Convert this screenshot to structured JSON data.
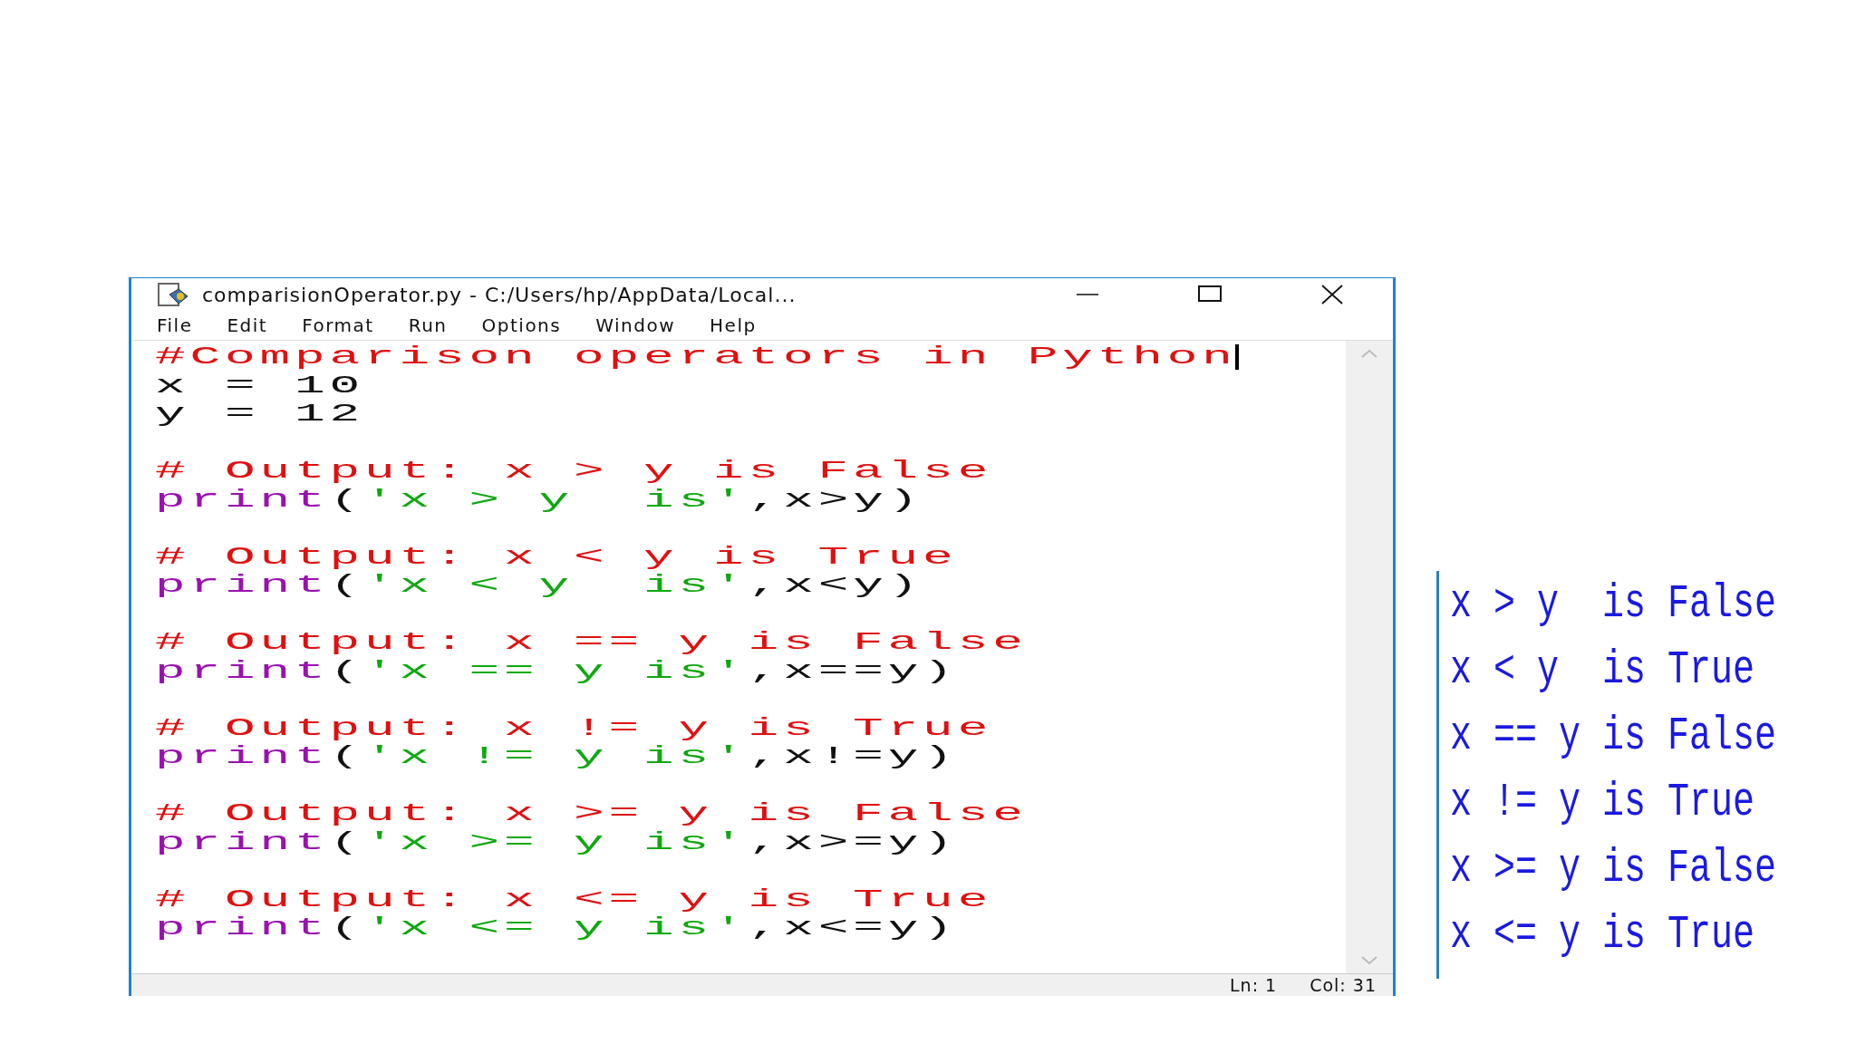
{
  "window": {
    "title": "comparisionOperator.py - C:/Users/hp/AppData/Local..."
  },
  "menu": [
    "File",
    "Edit",
    "Format",
    "Run",
    "Options",
    "Window",
    "Help"
  ],
  "editor": {
    "blocks": [
      {
        "lines": [
          {
            "cursor": true,
            "segments": [
              {
                "kind": "comment",
                "text": "#Comparison operators in Python"
              }
            ]
          },
          {
            "cursor": false,
            "segments": [
              {
                "kind": "plain",
                "text": "x = 10"
              }
            ]
          },
          {
            "cursor": false,
            "segments": [
              {
                "kind": "plain",
                "text": "y = 12"
              }
            ]
          }
        ]
      },
      {
        "lines": [
          {
            "cursor": false,
            "segments": [
              {
                "kind": "comment",
                "text": "# Output: x > y is False"
              }
            ]
          },
          {
            "cursor": false,
            "segments": [
              {
                "kind": "builtin",
                "text": "print"
              },
              {
                "kind": "plain",
                "text": "("
              },
              {
                "kind": "string",
                "text": "'x > y  is'"
              },
              {
                "kind": "plain",
                "text": ",x>y)"
              }
            ]
          }
        ]
      },
      {
        "lines": [
          {
            "cursor": false,
            "segments": [
              {
                "kind": "comment",
                "text": "# Output: x < y is True"
              }
            ]
          },
          {
            "cursor": false,
            "segments": [
              {
                "kind": "builtin",
                "text": "print"
              },
              {
                "kind": "plain",
                "text": "("
              },
              {
                "kind": "string",
                "text": "'x < y  is'"
              },
              {
                "kind": "plain",
                "text": ",x<y)"
              }
            ]
          }
        ]
      },
      {
        "lines": [
          {
            "cursor": false,
            "segments": [
              {
                "kind": "comment",
                "text": "# Output: x == y is False"
              }
            ]
          },
          {
            "cursor": false,
            "segments": [
              {
                "kind": "builtin",
                "text": "print"
              },
              {
                "kind": "plain",
                "text": "("
              },
              {
                "kind": "string",
                "text": "'x == y is'"
              },
              {
                "kind": "plain",
                "text": ",x==y)"
              }
            ]
          }
        ]
      },
      {
        "lines": [
          {
            "cursor": false,
            "segments": [
              {
                "kind": "comment",
                "text": "# Output: x != y is True"
              }
            ]
          },
          {
            "cursor": false,
            "segments": [
              {
                "kind": "builtin",
                "text": "print"
              },
              {
                "kind": "plain",
                "text": "("
              },
              {
                "kind": "string",
                "text": "'x != y is'"
              },
              {
                "kind": "plain",
                "text": ",x!=y)"
              }
            ]
          }
        ]
      },
      {
        "lines": [
          {
            "cursor": false,
            "segments": [
              {
                "kind": "comment",
                "text": "# Output: x >= y is False"
              }
            ]
          },
          {
            "cursor": false,
            "segments": [
              {
                "kind": "builtin",
                "text": "print"
              },
              {
                "kind": "plain",
                "text": "("
              },
              {
                "kind": "string",
                "text": "'x >= y is'"
              },
              {
                "kind": "plain",
                "text": ",x>=y)"
              }
            ]
          }
        ]
      },
      {
        "lines": [
          {
            "cursor": false,
            "segments": [
              {
                "kind": "comment",
                "text": "# Output: x <= y is True"
              }
            ]
          },
          {
            "cursor": false,
            "segments": [
              {
                "kind": "builtin",
                "text": "print"
              },
              {
                "kind": "plain",
                "text": "("
              },
              {
                "kind": "string",
                "text": "'x <= y is'"
              },
              {
                "kind": "plain",
                "text": ",x<=y)"
              }
            ]
          }
        ]
      }
    ]
  },
  "status_bar": {
    "line": "Ln: 1",
    "column": "Col: 31"
  },
  "output": {
    "lines": [
      "x > y  is False",
      "x < y  is True",
      "x == y is False",
      "x != y is True",
      "x >= y is False",
      "x <= y is True"
    ]
  }
}
